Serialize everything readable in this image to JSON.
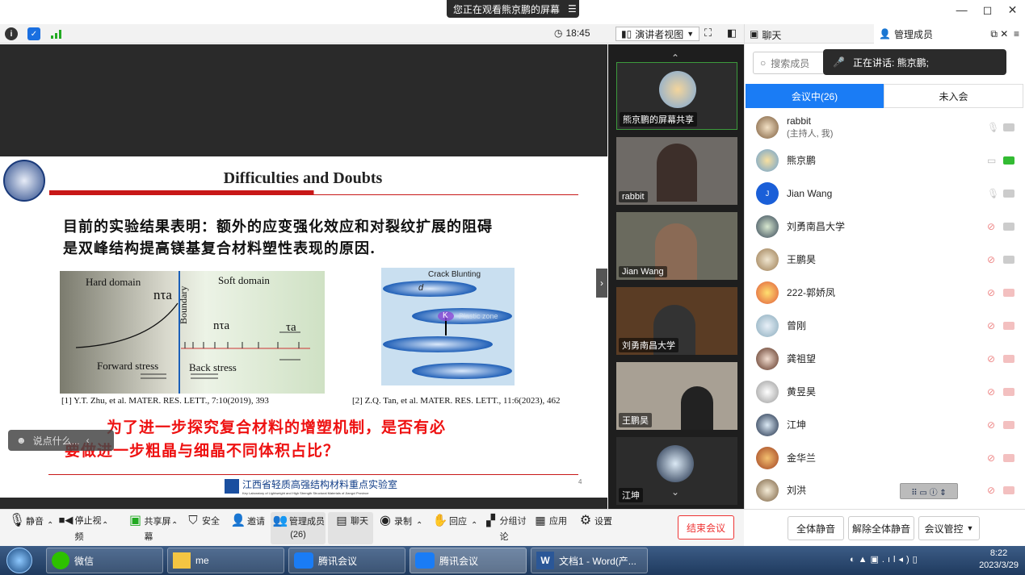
{
  "share_banner": {
    "text": "您正在观看熊京鹏的屏幕",
    "menu_icon": "menu-icon"
  },
  "window": {
    "minimize": "—",
    "restore": "◻",
    "close": "✕"
  },
  "topbar": {
    "time": "18:45",
    "presenter_view": "演讲者视图"
  },
  "slide": {
    "title": "Difficulties and Doubts",
    "text_line1": "目前的实验结果表明：额外的应变强化效应和对裂纹扩展的阻碍",
    "text_line2": "是双峰结构提高镁基复合材料塑性表现的原因.",
    "fig1": {
      "hard": "Hard domain",
      "soft": "Soft domain",
      "boundary": "Boundary",
      "ntau1": "nτa",
      "ntau2": "nτa",
      "tau": "τa",
      "forward": "Forward stress",
      "back": "Back stress"
    },
    "fig2": {
      "crack": "Crack Blunting",
      "d": "d",
      "plastic": "Plastic zone",
      "k": "K"
    },
    "caption1": "[1] Y.T. Zhu, et al. MATER. RES. LETT., 7:10(2019), 393",
    "caption2": "[2] Z.Q. Tan, et al. MATER. RES. LETT., 11:6(2023), 462",
    "red_line1": "为了进一步探究复合材料的增塑机制，是否有必",
    "red_line2": "要做进一步粗晶与细晶不同体积占比？",
    "lab": "江西省轻质高强结构材料重点实验室",
    "lab_en": "Key Laboratory of Lightweight and High Strength Structural Materials of Jiangxi Province",
    "page_no": "4"
  },
  "comment_box": {
    "placeholder": "说点什么..."
  },
  "video_tiles": [
    {
      "label": "熊京鹏的屏幕共享"
    },
    {
      "label": "rabbit"
    },
    {
      "label": "Jian Wang"
    },
    {
      "label": "刘勇南昌大学"
    },
    {
      "label": "王鹏昊"
    },
    {
      "label": "江坤"
    }
  ],
  "panel": {
    "tab_chat": "聊天",
    "tab_members": "管理成员",
    "search_placeholder": "搜索成员",
    "speaking": "正在讲话: 熊京鹏;",
    "in_meeting_tab": "会议中(26)",
    "not_joined_tab": "未入会",
    "members": [
      {
        "name": "rabbit",
        "sub": "(主持人, 我)"
      },
      {
        "name": "熊京鹏",
        "sub": ""
      },
      {
        "name": "Jian Wang",
        "sub": ""
      },
      {
        "name": "刘勇南昌大学",
        "sub": ""
      },
      {
        "name": "王鹏昊",
        "sub": ""
      },
      {
        "name": "222-郭娇凤",
        "sub": ""
      },
      {
        "name": "曾刚",
        "sub": ""
      },
      {
        "name": "龚祖望",
        "sub": ""
      },
      {
        "name": "黄昱昊",
        "sub": ""
      },
      {
        "name": "江坤",
        "sub": ""
      },
      {
        "name": "金华兰",
        "sub": ""
      },
      {
        "name": "刘洪",
        "sub": ""
      }
    ],
    "mute_all": "全体静音",
    "unmute_all": "解除全体静音",
    "meeting_control": "会议管控"
  },
  "bottombar": {
    "mute": "静音",
    "stop_video": "停止视频",
    "share": "共享屏幕",
    "security": "安全",
    "invite": "邀请",
    "members": "管理成员(26)",
    "chat": "聊天",
    "record": "录制",
    "react": "回应",
    "breakout": "分组讨论",
    "apps": "应用",
    "settings": "设置",
    "end": "结束会议"
  },
  "taskbar": {
    "wechat": "微信",
    "me": "me",
    "meeting1": "腾讯会议",
    "meeting2": "腾讯会议",
    "word": "文档1 - Word(产...",
    "time": "8:22",
    "date": "2023/3/29"
  },
  "colors": {
    "accent": "#1a7cf5",
    "red": "#e33333",
    "tab_active": "#1a7cf5"
  }
}
